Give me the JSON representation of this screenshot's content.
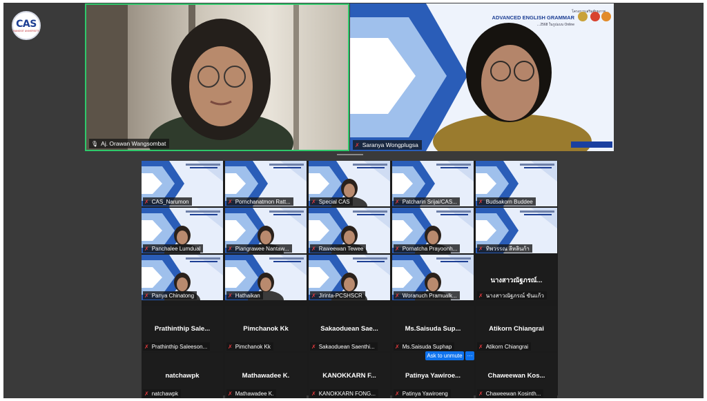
{
  "logo": {
    "text": "CAS",
    "subtext": "RANGSIT UNIVERSITY"
  },
  "speakers": [
    {
      "name": "Aj. Orawan Wangsombat"
    },
    {
      "name": "Saranya Wongplugsa",
      "slide_line1": "โครงการเสริมศักยภาพ…",
      "slide_title": "ADVANCED ENGLISH GRAMMAR",
      "slide_line2": "…2568 ในรูปแบบ Online"
    }
  ],
  "participants": [
    {
      "name": "CAS_Narumon"
    },
    {
      "name": "Pornchanatmon Ratt..."
    },
    {
      "name": "Special CAS"
    },
    {
      "name": "Patcharin Srijai/CAS..."
    },
    {
      "name": "Budsakorn Buddee"
    },
    {
      "name": "Panchalee Lumdual"
    },
    {
      "name": "Piangrawee Nantaw..."
    },
    {
      "name": "Raweewan Tewee"
    },
    {
      "name": "Pornatcha Prayoonh..."
    },
    {
      "name": "ทิพวรรณ ลีหลินก้า"
    },
    {
      "name": "Panya Chinatong"
    },
    {
      "name": "Hathaikan"
    },
    {
      "name": "Jirinta-PCSHSCR"
    },
    {
      "name": "Woranuch Pramualk..."
    },
    {
      "name": "นางสาวณัฐภรณ์ ขันแก้ว",
      "display": "นางสาวณัฐภรณ์..."
    },
    {
      "name": "Prathinthip Saleeson...",
      "display": "Prathinthip Sale..."
    },
    {
      "name": "Pimchanok Kk",
      "display": "Pimchanok Kk"
    },
    {
      "name": "Sakaoduean Saenthi...",
      "display": "Sakaoduean Sae..."
    },
    {
      "name": "Ms.Saisuda Suphap",
      "display": "Ms.Saisuda Sup..."
    },
    {
      "name": "Atikorn Chiangrai",
      "display": "Atikorn Chiangrai"
    },
    {
      "name": "natchawpk",
      "display": "natchawpk"
    },
    {
      "name": "Mathawadee K.",
      "display": "Mathawadee K."
    },
    {
      "name": "KANOKKARN FONG...",
      "display": "KANOKKARN F..."
    },
    {
      "name": "Patinya Yawiroeng",
      "display": "Patinya Yawiroe..."
    },
    {
      "name": "Chaweewan Kosinth...",
      "display": "Chaweewan Kos..."
    }
  ],
  "controls": {
    "ask_to_unmute": "Ask to unmute",
    "more": "···"
  },
  "colors": {
    "active_speaker_border": "#2ec96b",
    "accent_blue": "#0e72ed",
    "muted_icon": "#e5393c"
  }
}
